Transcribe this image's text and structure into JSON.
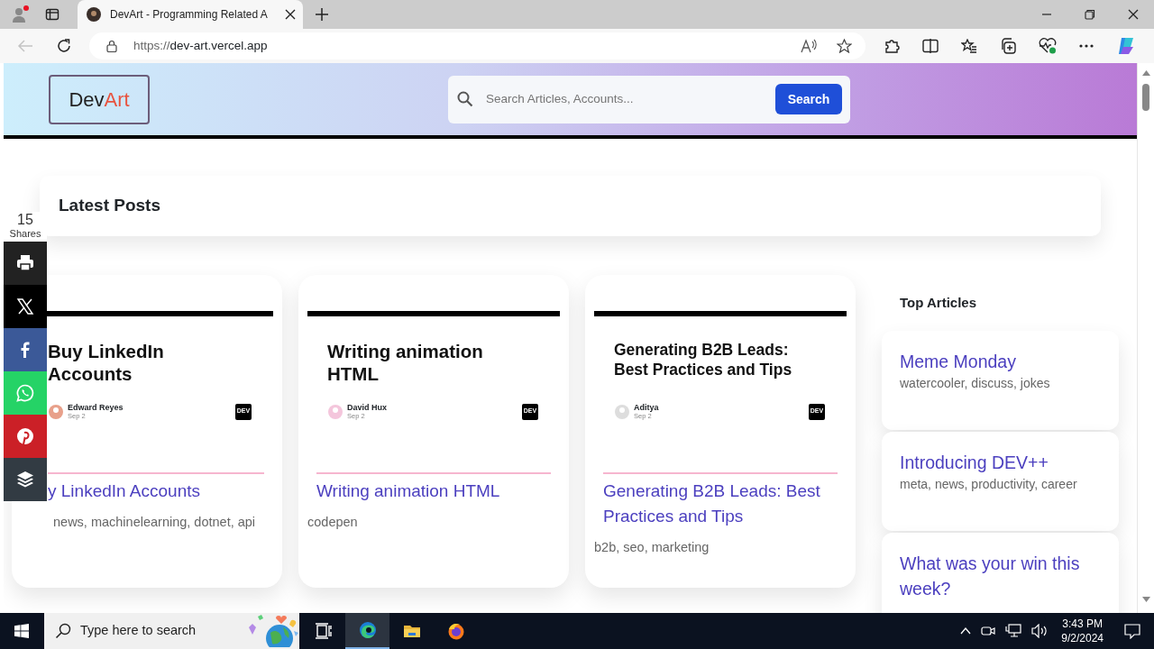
{
  "browser": {
    "tab": {
      "title": "DevArt - Programming Related A",
      "selected": true
    },
    "back_button": {
      "disabled": true
    },
    "address": {
      "scheme": "https://",
      "host": "dev-art.vercel.app"
    }
  },
  "site": {
    "logo": {
      "part_1": "Dev",
      "part_2": "Art"
    },
    "search": {
      "placeholder": "Search Articles, Accounts...",
      "button": "Search"
    }
  },
  "latest_posts": {
    "title": "Latest Posts"
  },
  "share_bar": {
    "count": "15",
    "label": "Shares",
    "buttons": [
      {
        "kind": "print",
        "color": "#222222"
      },
      {
        "kind": "x",
        "color": "#000000"
      },
      {
        "kind": "facebook",
        "color": "#3b5998"
      },
      {
        "kind": "whatsapp",
        "color": "#25d366"
      },
      {
        "kind": "pinterest",
        "color": "#cb2027"
      },
      {
        "kind": "buffer",
        "color": "#323b43"
      }
    ]
  },
  "posts": [
    {
      "cover": {
        "title": "Buy LinkedIn Accounts",
        "author": "Edward  Reyes",
        "date": "Sep 2",
        "badge": "DEV"
      },
      "title": "y LinkedIn Accounts",
      "tags": "news, machinelearning, dotnet, api"
    },
    {
      "cover": {
        "title": "Writing animation HTML",
        "author": "David Hux",
        "date": "Sep 2",
        "badge": "DEV"
      },
      "title": "Writing animation HTML",
      "tags": "codepen"
    },
    {
      "cover": {
        "title": "Generating B2B Leads: Best Practices and Tips",
        "author": "Aditya",
        "date": "Sep 2",
        "badge": "DEV"
      },
      "title": "Generating B2B Leads: Best Practices and Tips",
      "tags": "b2b, seo, marketing"
    }
  ],
  "top_articles": {
    "title": "Top Articles",
    "items": [
      {
        "title": "Meme Monday",
        "tags": "watercooler, discuss, jokes"
      },
      {
        "title": "Introducing DEV++",
        "tags": "meta, news, productivity, career"
      },
      {
        "title": "What was your win this week?"
      }
    ]
  },
  "taskbar": {
    "search_placeholder": "Type here to search",
    "apps": [
      {
        "kind": "task-view",
        "selected": false
      },
      {
        "kind": "edge",
        "selected": true
      },
      {
        "kind": "explorer",
        "selected": false
      },
      {
        "kind": "firefox",
        "selected": false
      }
    ],
    "time": "3:43 PM",
    "date": "9/2/2024"
  }
}
